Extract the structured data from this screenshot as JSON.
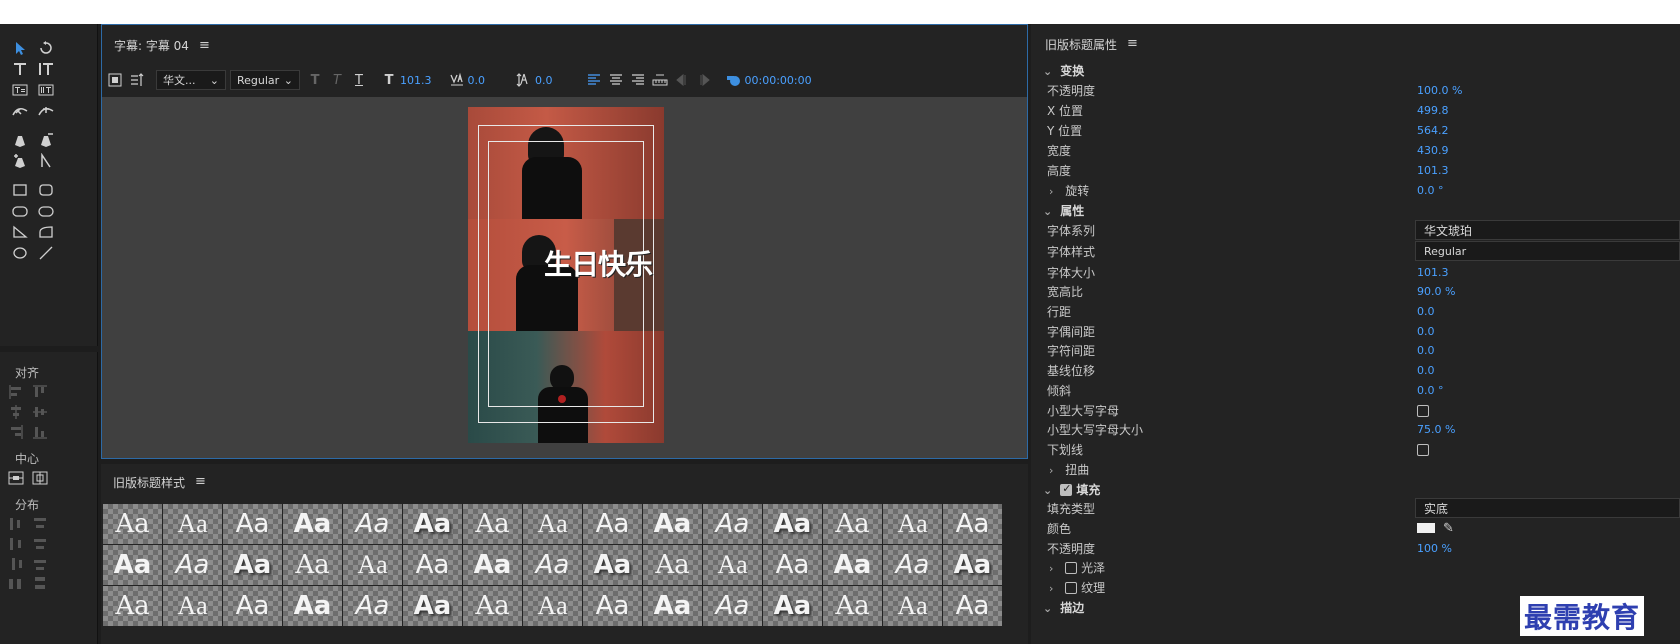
{
  "title_panel": {
    "title": "字幕: 字幕 04",
    "font_family": "华文...",
    "font_style": "Regular",
    "font_size": "101.3",
    "kerning": "0.0",
    "leading": "0.0",
    "timecode": "00:00:00:00",
    "caption_text": "生日快乐"
  },
  "align_panel": {
    "align_label": "对齐",
    "center_label": "中心",
    "distribute_label": "分布"
  },
  "styles_panel": {
    "title": "旧版标题样式",
    "swatch_text": "Aa",
    "rows": [
      [
        "Aa",
        "Aa",
        "Aa",
        "Aa",
        "Aa",
        "Aa",
        "Aa",
        "Aa",
        "Aa",
        "Aa",
        "Aa",
        "Aa",
        "Aa",
        "Aa",
        "Aa"
      ],
      [
        "Aa",
        "Aa",
        "Aa",
        "Aa",
        "Aa",
        "Aa",
        "Aa",
        "Aa",
        "Aa",
        "Aa",
        "Aa",
        "Aa",
        "Aa",
        "Aa",
        "Aa"
      ],
      [
        "Aa",
        "Aa",
        "Aa",
        "Aa",
        "Aa",
        "Aa",
        "Aa",
        "Aa",
        "Aa",
        "Aa",
        "Aa",
        "Aa",
        "Aa",
        "Aa",
        "Aa"
      ]
    ]
  },
  "props": {
    "title": "旧版标题属性",
    "transform": "变换",
    "opacity_label": "不透明度",
    "opacity_val": "100.0 %",
    "xpos_label": "X 位置",
    "xpos_val": "499.8",
    "ypos_label": "Y 位置",
    "ypos_val": "564.2",
    "width_label": "宽度",
    "width_val": "430.9",
    "height_label": "高度",
    "height_val": "101.3",
    "rotation_label": "旋转",
    "rotation_val": "0.0 °",
    "properties": "属性",
    "font_family_label": "字体系列",
    "font_family_val": "华文琥珀",
    "font_style_label": "字体样式",
    "font_style_val": "Regular",
    "font_size_label": "字体大小",
    "font_size_val": "101.3",
    "aspect_label": "宽高比",
    "aspect_val": "90.0 %",
    "leading_label": "行距",
    "leading_val": "0.0",
    "kerning_label": "字偶间距",
    "kerning_val": "0.0",
    "tracking_label": "字符间距",
    "tracking_val": "0.0",
    "baseline_label": "基线位移",
    "baseline_val": "0.0",
    "slant_label": "倾斜",
    "slant_val": "0.0 °",
    "smallcaps_label": "小型大写字母",
    "smallcaps_size_label": "小型大写字母大小",
    "smallcaps_size_val": "75.0 %",
    "underline_label": "下划线",
    "distort_label": "扭曲",
    "fill_label": "填充",
    "fill_type_label": "填充类型",
    "fill_type_val": "实底",
    "color_label": "颜色",
    "fill_opacity_label": "不透明度",
    "fill_opacity_val": "100 %",
    "sheen_label": "光泽",
    "texture_label": "纹理",
    "stroke_label": "描边"
  },
  "watermark": "最需教育",
  "colors": {
    "accent": "#4aa0ff",
    "panel": "#232323",
    "border_active": "#2d6aa6"
  }
}
